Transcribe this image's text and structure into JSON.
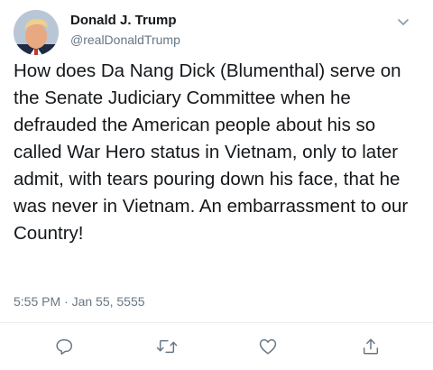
{
  "tweet": {
    "author": {
      "display_name": "Donald J. Trump",
      "handle": "@realDonaldTrump",
      "avatar_icon": "profile-photo-avatar"
    },
    "text": "How does Da Nang Dick (Blumenthal) serve on the Senate Judiciary Committee when he defrauded the American people about his so called War Hero status in Vietnam, only to later admit, with tears pouring down his face, that he was never in Vietnam. An embarrassment to our Country!",
    "timestamp": "5:55 PM · Jan 55, 5555"
  },
  "icons": {
    "menu": "chevron-down-icon",
    "reply": "reply-icon",
    "retweet": "retweet-icon",
    "like": "heart-icon",
    "share": "share-icon"
  },
  "colors": {
    "text": "#14171a",
    "secondary": "#657786",
    "icon": "#657786",
    "divider": "#e6ecf0"
  }
}
